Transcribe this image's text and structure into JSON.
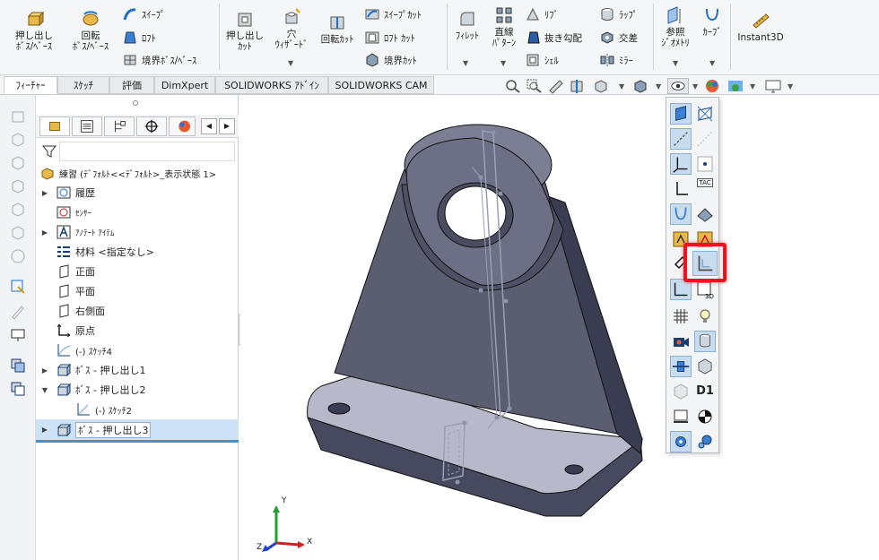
{
  "ribbon": {
    "extrude_boss": "押し出し\nﾎﾞｽ/ﾍﾞｰｽ",
    "revolve_boss": "回転\nﾎﾞｽ/ﾍﾞｰｽ",
    "sweep": "ｽｲｰﾌﾟ",
    "loft": "ﾛﾌﾄ",
    "boundary_boss": "境界ﾎﾞｽ/ﾍﾞｰｽ",
    "extrude_cut": "押し出し\nｶｯﾄ",
    "hole_wizard": "穴\nｳｨｻﾞｰﾄﾞ",
    "revolve_cut": "回転ｶｯﾄ",
    "swept_cut": "ｽｲｰﾌﾟｶｯﾄ",
    "loft_cut": "ﾛﾌﾄ ｶｯﾄ",
    "boundary_cut": "境界ｶｯﾄ",
    "fillet": "ﾌｨﾚｯﾄ",
    "linear_pattern": "直線\nﾊﾟﾀｰﾝ",
    "rib": "ﾘﾌﾞ",
    "draft": "抜き勾配",
    "shell": "ｼｪﾙ",
    "wrap": "ﾗｯﾌﾟ",
    "intersect": "交差",
    "mirror": "ﾐﾗｰ",
    "ref_geometry": "参照\nｼﾞｵﾒﾄﾘ",
    "curves": "ｶｰﾌﾞ",
    "instant3d": "Instant3D"
  },
  "tabs": [
    "ﾌｨｰﾁｬｰ",
    "ｽｹｯﾁ",
    "評価",
    "DimXpert",
    "SOLIDWORKS ｱﾄﾞｲﾝ",
    "SOLIDWORKS CAM"
  ],
  "tree": {
    "root": "練習 (ﾃﾞﾌｫﾙﾄ<<ﾃﾞﾌｫﾙﾄ>_表示状態 1>",
    "items": [
      {
        "label": "履歴",
        "expand": "▶"
      },
      {
        "label": "ｾﾝｻｰ",
        "expand": ""
      },
      {
        "label": "ｱﾉﾃｰﾄ ｱｲﾃﾑ",
        "expand": "▶"
      },
      {
        "label": "材料 <指定なし>",
        "expand": ""
      },
      {
        "label": "正面",
        "expand": ""
      },
      {
        "label": "平面",
        "expand": ""
      },
      {
        "label": "右側面",
        "expand": ""
      },
      {
        "label": "原点",
        "expand": ""
      },
      {
        "label": "(-) ｽｹｯﾁ4",
        "expand": ""
      },
      {
        "label": "ﾎﾞｽ - 押し出し1",
        "expand": "▶"
      },
      {
        "label": "ﾎﾞｽ - 押し出し2",
        "expand": "▼"
      },
      {
        "label": "(-) ｽｹｯﾁ2",
        "expand": ""
      },
      {
        "label": "ﾎﾞｽ - 押し出し3",
        "expand": "▶"
      }
    ]
  },
  "palette": {
    "d1_label": "D1",
    "tac_label": "TAC"
  },
  "triad": {
    "x": "X",
    "y": "Y",
    "z": "Z"
  },
  "colors": {
    "accent": "#4a90c8",
    "highlight": "#e8141e",
    "part": "#5b5d70"
  }
}
